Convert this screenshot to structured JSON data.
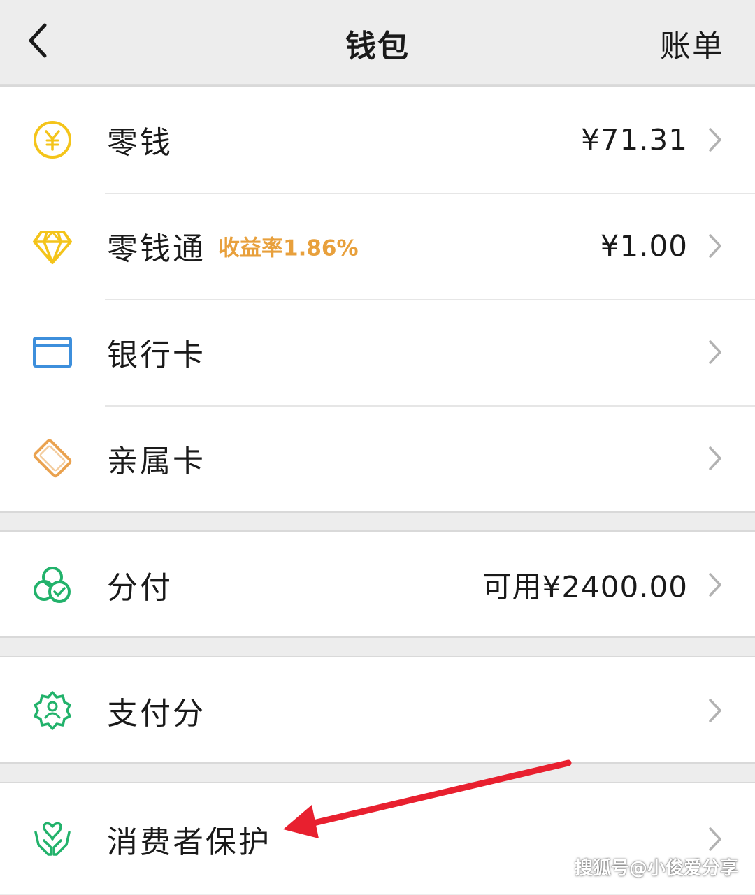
{
  "nav": {
    "title": "钱包",
    "bill_label": "账单"
  },
  "groups": [
    {
      "items": [
        {
          "label": "零钱",
          "value": "¥71.31",
          "icon": "yuan-coin-icon"
        },
        {
          "label": "零钱通",
          "badge": "收益率1.86%",
          "value": "¥1.00",
          "icon": "diamond-icon"
        },
        {
          "label": "银行卡",
          "icon": "bank-card-icon"
        },
        {
          "label": "亲属卡",
          "icon": "family-card-icon"
        }
      ]
    },
    {
      "items": [
        {
          "label": "分付",
          "value": "可用¥2400.00",
          "icon": "fenfu-icon"
        }
      ]
    },
    {
      "items": [
        {
          "label": "支付分",
          "icon": "payscore-badge-icon"
        }
      ]
    },
    {
      "items": [
        {
          "label": "消费者保护",
          "icon": "consumer-protection-hands-icon"
        }
      ]
    }
  ],
  "watermark": "搜狐号@小俊爱分享",
  "colors": {
    "background": "#ededed",
    "card": "#ffffff",
    "yellow_icon": "#f4c41a",
    "blue_icon": "#3d8fdc",
    "orange_icon": "#eaa24f",
    "green_icon": "#22b26b",
    "badge_orange": "#e8a03c",
    "arrow_red": "#e8202f"
  }
}
